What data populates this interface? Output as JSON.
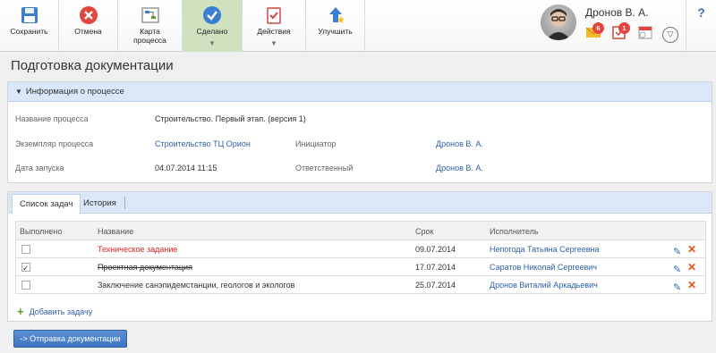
{
  "toolbar": {
    "save": "Сохранить",
    "cancel": "Отмена",
    "map_line1": "Карта",
    "map_line2": "процесса",
    "done": "Сделано",
    "actions": "Действия",
    "improve": "Улучшить"
  },
  "user": {
    "name": "Дронов В. А.",
    "mail_count": "6",
    "task_count": "1"
  },
  "page": {
    "title": "Подготовка документации"
  },
  "info": {
    "header": "Информация о процессе",
    "process_name_label": "Название процесса",
    "process_name_value": "Строительство. Первый этап. (версия 1)",
    "instance_label": "Экземпляр процесса",
    "instance_value": "Строительство ТЦ Орион",
    "initiator_label": "Инициатор",
    "initiator_value": "Дронов В. А.",
    "start_label": "Дата запуска",
    "start_value": "04.07.2014 11:15",
    "responsible_label": "Ответственный",
    "responsible_value": "Дронов В. А."
  },
  "tabs": {
    "tasks": "Список задач",
    "history": "История"
  },
  "grid": {
    "col_done": "Выполнено",
    "col_name": "Название",
    "col_due": "Срок",
    "col_assignee": "Исполнитель",
    "rows": [
      {
        "name": "Техническое задание",
        "due": "09.07.2014",
        "assignee": "Непогода Татьяна Сергеевна",
        "done": false
      },
      {
        "name": "Проектная документация",
        "due": "17.07.2014",
        "assignee": "Саратов Николай Сергеевич",
        "done": true
      },
      {
        "name": "Заключение санэпидемстанции, геологов и экологов",
        "due": "25.07.2014",
        "assignee": "Дронов Виталий Аркадьевич",
        "done": false
      }
    ]
  },
  "add_task": "Добавить задачу",
  "send_button": "-> Отправка документации",
  "colors": {
    "accent_blue": "#2f5fa7",
    "panel_header": "#d9e7f8",
    "active_green": "#cfe1bf",
    "overdue_red": "#d22222"
  }
}
